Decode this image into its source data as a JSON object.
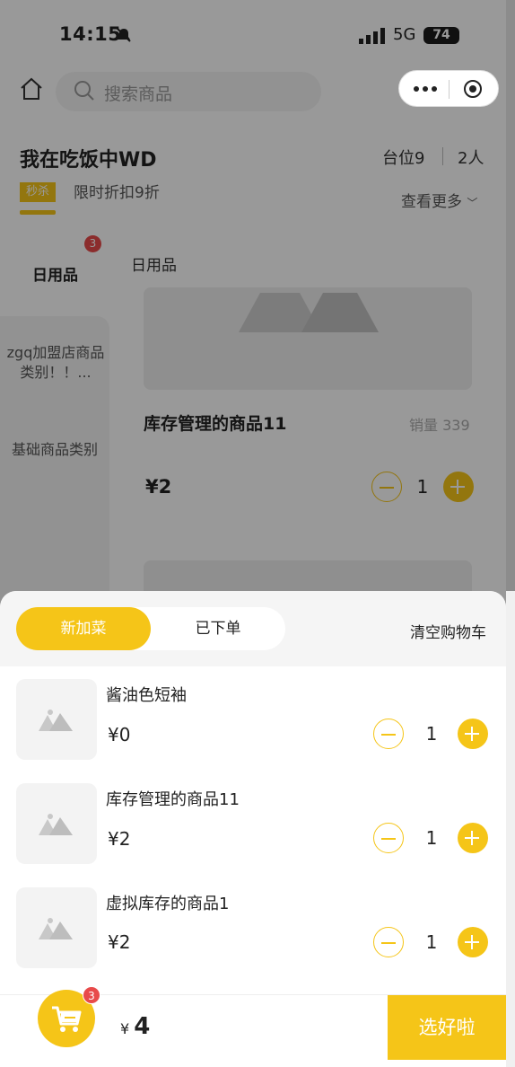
{
  "status_bar": {
    "time": "14:15",
    "network": "5G",
    "battery": "74"
  },
  "header": {
    "search_placeholder": "搜索商品"
  },
  "store": {
    "name": "我在吃饭中WD",
    "table": "台位9",
    "people": "2人",
    "tag": "秒杀",
    "promo": "限时折扣9折",
    "see_more": "查看更多"
  },
  "tabs": [
    {
      "label": "日用品",
      "badge": "3"
    }
  ],
  "category": {
    "title": "日用品"
  },
  "sidebar": {
    "items": [
      "zgq加盟店商品类别！！...",
      "基础商品类别"
    ]
  },
  "product": {
    "name": "库存管理的商品11",
    "sales": "销量 339",
    "price": "¥2",
    "qty": "1"
  },
  "cart": {
    "tabs": {
      "active": "新加菜",
      "inactive": "已下单"
    },
    "clear": "清空购物车",
    "items": [
      {
        "name": "酱油色短袖",
        "price": "¥0",
        "qty": "1"
      },
      {
        "name": "库存管理的商品11",
        "price": "¥2",
        "qty": "1"
      },
      {
        "name": "虚拟库存的商品1",
        "price": "¥2",
        "qty": "1"
      }
    ],
    "badge": "3",
    "total_symbol": "¥",
    "total": "4",
    "submit": "选好啦"
  },
  "colors": {
    "accent": "#f5c518",
    "badge": "#e84a4a"
  }
}
